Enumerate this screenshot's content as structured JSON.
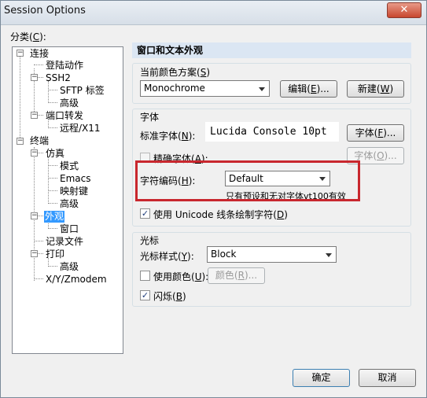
{
  "window": {
    "title": "Session Options",
    "close_glyph": "✕"
  },
  "category_label": "分类",
  "category_hotkey": "C",
  "tree": [
    "连接",
    "登陆动作",
    "SSH2",
    "SFTP 标签",
    "高级",
    "端口转发",
    "远程/X11",
    "终端",
    "仿真",
    "模式",
    "Emacs",
    "映射键",
    "高级",
    "外观",
    "窗口",
    "记录文件",
    "打印",
    "高级",
    "X/Y/Zmodem"
  ],
  "panel_header": "窗口和文本外观",
  "color_scheme": {
    "label": "当前颜色方案",
    "hotkey": "S",
    "value": "Monochrome",
    "edit_button": "编辑",
    "edit_hotkey": "E",
    "new_button": "新建",
    "new_hotkey": "W"
  },
  "font_group": {
    "title": "字体",
    "standard_label": "标准字体",
    "standard_hotkey": "N",
    "font_preview": "Lucida Console 10pt",
    "font_button": "字体",
    "font_button_hotkey": "F",
    "precise_label": "精确字体",
    "precise_hotkey": "A",
    "precise_checked": false,
    "font2_button": "字体",
    "font2_hotkey": "O",
    "encoding_label": "字符编码",
    "encoding_hotkey": "H",
    "encoding_value": "Default",
    "vt100_note": "只有预设和无对字体vt100有效",
    "unicode_label": "使用 Unicode 线条绘制字符",
    "unicode_hotkey": "D",
    "unicode_checked": true
  },
  "cursor_group": {
    "title": "光标",
    "style_label": "光标样式",
    "style_hotkey": "Y",
    "style_value": "Block",
    "use_color_label": "使用颜色",
    "use_color_hotkey": "U",
    "use_color_checked": false,
    "color_button": "颜色",
    "color_hotkey": "R",
    "blink_label": "闪烁",
    "blink_hotkey": "B",
    "blink_checked": true
  },
  "buttons": {
    "ok": "确定",
    "cancel": "取消"
  },
  "check_glyph": "✓",
  "accent_color": "#3399ff",
  "highlight_color": "#c8272e"
}
